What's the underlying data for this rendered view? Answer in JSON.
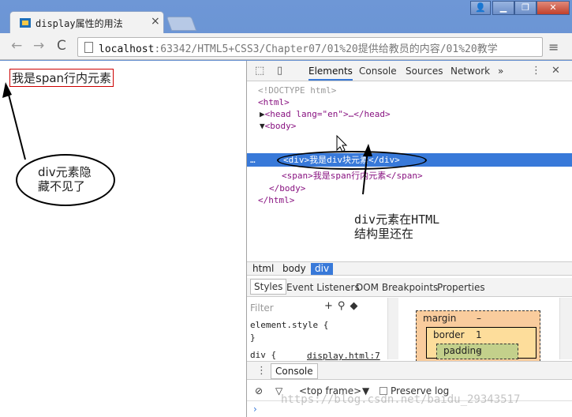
{
  "window": {
    "tab_title": "display属性的用法",
    "tab_close": "×",
    "user_icon": "👤",
    "min_label": "▁",
    "max_label": "❐",
    "close_label": "✕"
  },
  "toolbar": {
    "back": "←",
    "forward": "→",
    "reload": "C",
    "url_host": "localhost",
    "url_rest": ":63342/HTML5+CSS3/Chapter07/01%20提供给教员的内容/01%20教学",
    "menu": "≡"
  },
  "page": {
    "span_text": "我是span行内元素",
    "annotation_1": "div元素隐藏不见了"
  },
  "devtools": {
    "tabs": [
      "Elements",
      "Console",
      "Sources",
      "Network"
    ],
    "more": "»",
    "dom": {
      "doctype": "<!DOCTYPE html>",
      "html_open": "<html>",
      "head": "<head lang=\"en\">…</head>",
      "body_open": "<body>",
      "div_line": "<div>我是div块元素</div>",
      "span_line": "<span>我是span行内元素</span>",
      "body_close": "</body>",
      "html_close": "</html>",
      "ellipsis": "…"
    },
    "annotation_2": "div元素在HTML结构里还在",
    "breadcrumbs": [
      "html",
      "body",
      "div"
    ],
    "subtabs": [
      "Styles",
      "Event Listeners",
      "DOM Breakpoints",
      "Properties"
    ],
    "filter_placeholder": "Filter",
    "styles_lines": [
      "element.style {",
      "}",
      "div {"
    ],
    "source_link": "display.html:7",
    "box_model": {
      "margin": "margin",
      "margin_val": "–",
      "border": "border",
      "border_val": "1",
      "padding": "padding",
      "padding_val": "–"
    },
    "console_tab": "Console",
    "console_context": "<top frame>",
    "preserve_log": "Preserve log",
    "prompt": "›"
  },
  "watermark": "https://blog.csdn.net/baidu_29343517",
  "colors": {
    "selection": "#3879d9",
    "tag": "#881280",
    "annotation_border": "#000000"
  }
}
